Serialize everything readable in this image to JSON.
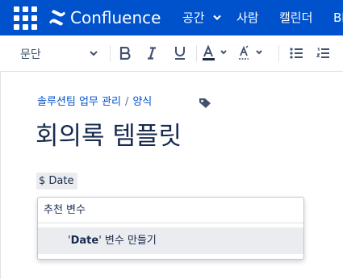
{
  "topbar": {
    "brand": "Confluence",
    "nav": [
      "공간",
      "사람",
      "캘린더",
      "Bl"
    ]
  },
  "toolbar": {
    "style_value": "문단",
    "buttons": [
      "bold-icon",
      "italic-icon",
      "underline-icon",
      "text-color-icon",
      "clear-format-icon",
      "bullet-list-icon",
      "numbered-list-icon"
    ]
  },
  "breadcrumb": {
    "items": [
      "솔루션팀 업무 관리",
      "양식"
    ],
    "separator": "/"
  },
  "page": {
    "title": "회의록 템플릿",
    "variable_token": "$ Date"
  },
  "suggestion": {
    "header": "추천 변수",
    "item_quote_open": "'",
    "item_name": "Date",
    "item_quote_close": "'",
    "item_suffix": " 변수 만들기"
  },
  "colors": {
    "header_bg": "#0052cc",
    "text": "#172b4d",
    "link": "#0052cc",
    "token_bg": "#ebecf0"
  }
}
